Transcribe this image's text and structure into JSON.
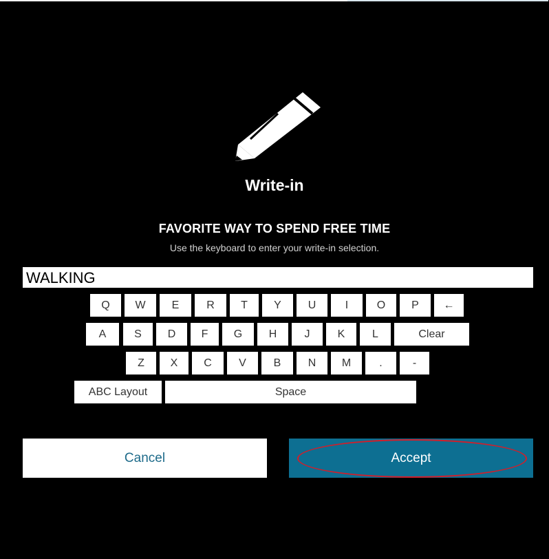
{
  "dialog": {
    "icon": "pencil-icon",
    "title": "Write-in",
    "contest_title": "FAVORITE WAY TO SPEND FREE TIME",
    "instructions": "Use the keyboard to enter your write-in selection.",
    "input_value": "WALKING"
  },
  "keyboard": {
    "row1": [
      "Q",
      "W",
      "E",
      "R",
      "T",
      "Y",
      "U",
      "I",
      "O",
      "P",
      "←"
    ],
    "row2": [
      "A",
      "S",
      "D",
      "F",
      "G",
      "H",
      "J",
      "K",
      "L",
      "Clear"
    ],
    "row3": [
      "Z",
      "X",
      "C",
      "V",
      "B",
      "N",
      "M",
      ".",
      "-"
    ],
    "row4": [
      "ABC Layout",
      "Space"
    ]
  },
  "buttons": {
    "cancel": "Cancel",
    "accept": "Accept"
  },
  "colors": {
    "background": "#000000",
    "accent": "#0d6f92",
    "annotation": "#d21e2a"
  }
}
